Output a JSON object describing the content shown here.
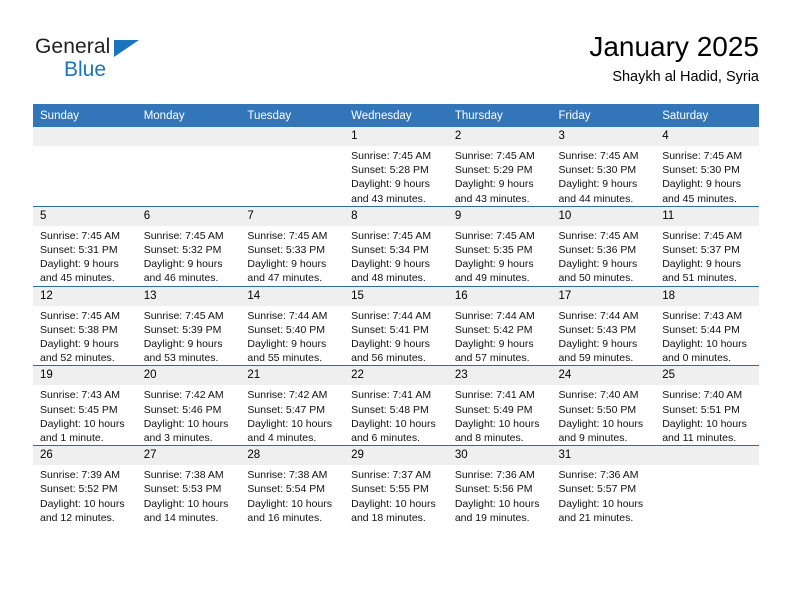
{
  "logo": {
    "word1": "General",
    "word2": "Blue",
    "triangle_color": "#1c75bc"
  },
  "header": {
    "title": "January 2025",
    "subtitle": "Shaykh al Hadid, Syria"
  },
  "theme": {
    "header_bg": "#3275b8",
    "row_divider": "#2e6da4",
    "daynum_bg": "#efefef"
  },
  "weekday_headers": [
    "Sunday",
    "Monday",
    "Tuesday",
    "Wednesday",
    "Thursday",
    "Friday",
    "Saturday"
  ],
  "weeks": [
    [
      {
        "day": "",
        "empty": true,
        "line1": "",
        "line2": "",
        "line3": "",
        "line4": ""
      },
      {
        "day": "",
        "empty": true,
        "line1": "",
        "line2": "",
        "line3": "",
        "line4": ""
      },
      {
        "day": "",
        "empty": true,
        "line1": "",
        "line2": "",
        "line3": "",
        "line4": ""
      },
      {
        "day": "1",
        "empty": false,
        "line1": "Sunrise: 7:45 AM",
        "line2": "Sunset: 5:28 PM",
        "line3": "Daylight: 9 hours",
        "line4": "and 43 minutes."
      },
      {
        "day": "2",
        "empty": false,
        "line1": "Sunrise: 7:45 AM",
        "line2": "Sunset: 5:29 PM",
        "line3": "Daylight: 9 hours",
        "line4": "and 43 minutes."
      },
      {
        "day": "3",
        "empty": false,
        "line1": "Sunrise: 7:45 AM",
        "line2": "Sunset: 5:30 PM",
        "line3": "Daylight: 9 hours",
        "line4": "and 44 minutes."
      },
      {
        "day": "4",
        "empty": false,
        "line1": "Sunrise: 7:45 AM",
        "line2": "Sunset: 5:30 PM",
        "line3": "Daylight: 9 hours",
        "line4": "and 45 minutes."
      }
    ],
    [
      {
        "day": "5",
        "empty": false,
        "line1": "Sunrise: 7:45 AM",
        "line2": "Sunset: 5:31 PM",
        "line3": "Daylight: 9 hours",
        "line4": "and 45 minutes."
      },
      {
        "day": "6",
        "empty": false,
        "line1": "Sunrise: 7:45 AM",
        "line2": "Sunset: 5:32 PM",
        "line3": "Daylight: 9 hours",
        "line4": "and 46 minutes."
      },
      {
        "day": "7",
        "empty": false,
        "line1": "Sunrise: 7:45 AM",
        "line2": "Sunset: 5:33 PM",
        "line3": "Daylight: 9 hours",
        "line4": "and 47 minutes."
      },
      {
        "day": "8",
        "empty": false,
        "line1": "Sunrise: 7:45 AM",
        "line2": "Sunset: 5:34 PM",
        "line3": "Daylight: 9 hours",
        "line4": "and 48 minutes."
      },
      {
        "day": "9",
        "empty": false,
        "line1": "Sunrise: 7:45 AM",
        "line2": "Sunset: 5:35 PM",
        "line3": "Daylight: 9 hours",
        "line4": "and 49 minutes."
      },
      {
        "day": "10",
        "empty": false,
        "line1": "Sunrise: 7:45 AM",
        "line2": "Sunset: 5:36 PM",
        "line3": "Daylight: 9 hours",
        "line4": "and 50 minutes."
      },
      {
        "day": "11",
        "empty": false,
        "line1": "Sunrise: 7:45 AM",
        "line2": "Sunset: 5:37 PM",
        "line3": "Daylight: 9 hours",
        "line4": "and 51 minutes."
      }
    ],
    [
      {
        "day": "12",
        "empty": false,
        "line1": "Sunrise: 7:45 AM",
        "line2": "Sunset: 5:38 PM",
        "line3": "Daylight: 9 hours",
        "line4": "and 52 minutes."
      },
      {
        "day": "13",
        "empty": false,
        "line1": "Sunrise: 7:45 AM",
        "line2": "Sunset: 5:39 PM",
        "line3": "Daylight: 9 hours",
        "line4": "and 53 minutes."
      },
      {
        "day": "14",
        "empty": false,
        "line1": "Sunrise: 7:44 AM",
        "line2": "Sunset: 5:40 PM",
        "line3": "Daylight: 9 hours",
        "line4": "and 55 minutes."
      },
      {
        "day": "15",
        "empty": false,
        "line1": "Sunrise: 7:44 AM",
        "line2": "Sunset: 5:41 PM",
        "line3": "Daylight: 9 hours",
        "line4": "and 56 minutes."
      },
      {
        "day": "16",
        "empty": false,
        "line1": "Sunrise: 7:44 AM",
        "line2": "Sunset: 5:42 PM",
        "line3": "Daylight: 9 hours",
        "line4": "and 57 minutes."
      },
      {
        "day": "17",
        "empty": false,
        "line1": "Sunrise: 7:44 AM",
        "line2": "Sunset: 5:43 PM",
        "line3": "Daylight: 9 hours",
        "line4": "and 59 minutes."
      },
      {
        "day": "18",
        "empty": false,
        "line1": "Sunrise: 7:43 AM",
        "line2": "Sunset: 5:44 PM",
        "line3": "Daylight: 10 hours",
        "line4": "and 0 minutes."
      }
    ],
    [
      {
        "day": "19",
        "empty": false,
        "line1": "Sunrise: 7:43 AM",
        "line2": "Sunset: 5:45 PM",
        "line3": "Daylight: 10 hours",
        "line4": "and 1 minute."
      },
      {
        "day": "20",
        "empty": false,
        "line1": "Sunrise: 7:42 AM",
        "line2": "Sunset: 5:46 PM",
        "line3": "Daylight: 10 hours",
        "line4": "and 3 minutes."
      },
      {
        "day": "21",
        "empty": false,
        "line1": "Sunrise: 7:42 AM",
        "line2": "Sunset: 5:47 PM",
        "line3": "Daylight: 10 hours",
        "line4": "and 4 minutes."
      },
      {
        "day": "22",
        "empty": false,
        "line1": "Sunrise: 7:41 AM",
        "line2": "Sunset: 5:48 PM",
        "line3": "Daylight: 10 hours",
        "line4": "and 6 minutes."
      },
      {
        "day": "23",
        "empty": false,
        "line1": "Sunrise: 7:41 AM",
        "line2": "Sunset: 5:49 PM",
        "line3": "Daylight: 10 hours",
        "line4": "and 8 minutes."
      },
      {
        "day": "24",
        "empty": false,
        "line1": "Sunrise: 7:40 AM",
        "line2": "Sunset: 5:50 PM",
        "line3": "Daylight: 10 hours",
        "line4": "and 9 minutes."
      },
      {
        "day": "25",
        "empty": false,
        "line1": "Sunrise: 7:40 AM",
        "line2": "Sunset: 5:51 PM",
        "line3": "Daylight: 10 hours",
        "line4": "and 11 minutes."
      }
    ],
    [
      {
        "day": "26",
        "empty": false,
        "line1": "Sunrise: 7:39 AM",
        "line2": "Sunset: 5:52 PM",
        "line3": "Daylight: 10 hours",
        "line4": "and 12 minutes."
      },
      {
        "day": "27",
        "empty": false,
        "line1": "Sunrise: 7:38 AM",
        "line2": "Sunset: 5:53 PM",
        "line3": "Daylight: 10 hours",
        "line4": "and 14 minutes."
      },
      {
        "day": "28",
        "empty": false,
        "line1": "Sunrise: 7:38 AM",
        "line2": "Sunset: 5:54 PM",
        "line3": "Daylight: 10 hours",
        "line4": "and 16 minutes."
      },
      {
        "day": "29",
        "empty": false,
        "line1": "Sunrise: 7:37 AM",
        "line2": "Sunset: 5:55 PM",
        "line3": "Daylight: 10 hours",
        "line4": "and 18 minutes."
      },
      {
        "day": "30",
        "empty": false,
        "line1": "Sunrise: 7:36 AM",
        "line2": "Sunset: 5:56 PM",
        "line3": "Daylight: 10 hours",
        "line4": "and 19 minutes."
      },
      {
        "day": "31",
        "empty": false,
        "line1": "Sunrise: 7:36 AM",
        "line2": "Sunset: 5:57 PM",
        "line3": "Daylight: 10 hours",
        "line4": "and 21 minutes."
      },
      {
        "day": "",
        "empty": true,
        "line1": "",
        "line2": "",
        "line3": "",
        "line4": ""
      }
    ]
  ]
}
